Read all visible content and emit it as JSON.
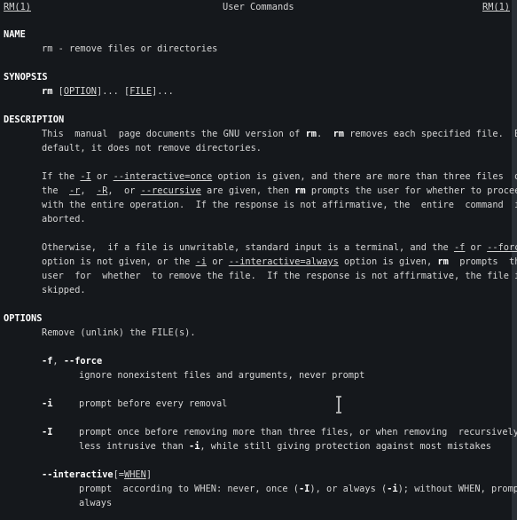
{
  "header": {
    "left_title": "RM(1)",
    "center_title": "User Commands",
    "right_title": "RM(1)"
  },
  "sections": {
    "name": {
      "heading": "NAME",
      "text": "rm - remove files or directories"
    },
    "synopsis": {
      "heading": "SYNOPSIS",
      "cmd": "rm",
      "rest1": " [",
      "option": "OPTION",
      "rest2": "]... [",
      "file": "FILE",
      "rest3": "]..."
    },
    "description": {
      "heading": "DESCRIPTION",
      "p1_l1_a": "This  manual  page documents the GNU version of ",
      "p1_l1_rm": "rm",
      "p1_l1_b": ".  ",
      "p1_l1_rm2": "rm",
      "p1_l1_c": " removes each specified file.  By",
      "p1_l2": "default, it does not remove directories.",
      "p2_l1_a": "If the ",
      "p2_l1_I": "-I",
      "p2_l1_b": " or ",
      "p2_l1_int": "--interactive=once",
      "p2_l1_c": " option is given, and there are more than three files  or",
      "p2_l2_a": "the  ",
      "p2_l2_r": "-r",
      "p2_l2_b": ",  ",
      "p2_l2_R": "-R",
      "p2_l2_c": ",  or ",
      "p2_l2_rec": "--recursive",
      "p2_l2_d": " are given, then ",
      "p2_l2_rm": "rm",
      "p2_l2_e": " prompts the user for whether to proceed",
      "p2_l3": "with the entire operation.  If the response is not affirmative, the  entire  command  is",
      "p2_l4": "aborted.",
      "p3_l1_a": "Otherwise,  if a file is unwritable, standard input is a terminal, and the ",
      "p3_l1_f": "-f",
      "p3_l1_b": " or ",
      "p3_l1_force": "--force",
      "p3_l2_a": "option is not given, or the ",
      "p3_l2_i": "-i",
      "p3_l2_b": " or ",
      "p3_l2_always": "--interactive=always",
      "p3_l2_c": " option is given, ",
      "p3_l2_rm": "rm",
      "p3_l2_d": "  prompts  the",
      "p3_l3": "user  for  whether  to remove the file.  If the response is not affirmative, the file is",
      "p3_l4": "skipped."
    },
    "options": {
      "heading": "OPTIONS",
      "intro": "Remove (unlink) the FILE(s).",
      "f_flag": "-f",
      "f_sep": ", ",
      "f_long": "--force",
      "f_desc": "ignore nonexistent files and arguments, never prompt",
      "i_flag": "-i",
      "i_desc": "prompt before every removal",
      "I_flag": "-I",
      "I_desc1": "prompt once before removing more than three files, or when removing  recursively;",
      "I_desc2_a": "less intrusive than ",
      "I_desc2_i": "-i",
      "I_desc2_b": ", while still giving protection against most mistakes",
      "int_flag": "--interactive",
      "int_br1": "[=",
      "int_when": "WHEN",
      "int_br2": "]",
      "int_desc1_a": "prompt  according to WHEN: never, once (",
      "int_desc1_I": "-I",
      "int_desc1_b": "), or always (",
      "int_desc1_i": "-i",
      "int_desc1_c": "); without WHEN, prompt",
      "int_desc2": "always"
    }
  },
  "icons": {
    "cursor": "text-cursor-icon"
  },
  "colors": {
    "background": "#15181c",
    "text": "#d4d4d4",
    "bold": "#ffffff"
  }
}
